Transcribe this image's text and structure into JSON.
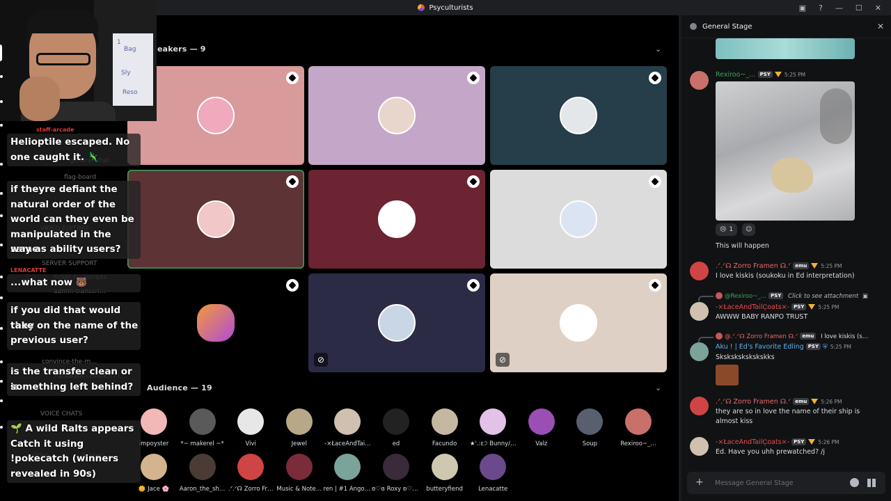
{
  "window": {
    "title": "Psyculturists",
    "controls": [
      "▣",
      "?",
      "—",
      "☐",
      "✕"
    ]
  },
  "stage": {
    "speakers_label": "eakers — 9",
    "audience_label": "Audience — 19",
    "speakers": [
      {
        "color": "#d89a9a",
        "avatar": "#f0a9bd",
        "muted": false
      },
      {
        "color": "#c4a7c8",
        "avatar": "#e8d6cc",
        "muted": false
      },
      {
        "color": "#263d4a",
        "avatar": "#e3e7ea",
        "muted": false
      },
      {
        "color": "#5e3336",
        "avatar": "#f1c7c7",
        "muted": false
      },
      {
        "color": "#6c2332",
        "avatar": "#ffffff",
        "muted": false
      },
      {
        "color": "#dcdcdc",
        "avatar": "#dbe4f2",
        "muted": false
      },
      {
        "color": "#000000",
        "avatar": "#a85fd6",
        "muted": false
      },
      {
        "color": "#2c2b45",
        "avatar": "#c8d6e5",
        "muted": true
      },
      {
        "color": "#ded0c4",
        "avatar": "#ffffff",
        "muted": true
      }
    ],
    "audience": [
      {
        "name": "impoyster",
        "color": "#f2b7b7"
      },
      {
        "name": "*~ makerel ~*",
        "color": "#5a5a5a"
      },
      {
        "name": "Vivi",
        "color": "#e7e7e7"
      },
      {
        "name": "Jewel",
        "color": "#b8a888"
      },
      {
        "name": "-×ŁaceAndTai…",
        "color": "#cfc0b0"
      },
      {
        "name": "ed",
        "color": "#222222"
      },
      {
        "name": "Facundo",
        "color": "#c6b8a0"
      },
      {
        "name": "★'.:ɛ੭ Bunny/…",
        "color": "#e3c2e8"
      },
      {
        "name": "Valz",
        "color": "#9b4fb5"
      },
      {
        "name": "Soup",
        "color": "#586070"
      },
      {
        "name": "Rexiroo~_…",
        "color": "#c9706a"
      },
      {
        "name": "🌼 Jace 🌸",
        "color": "#d4b48e"
      },
      {
        "name": "Aaron_the_sh…",
        "color": "#4a3c34"
      },
      {
        "name": ".ᐟ.ᐟ☊ Zorro Fr…",
        "color": "#cf4444"
      },
      {
        "name": "Music & Note…",
        "color": "#7a2c3a"
      },
      {
        "name": "ren | #1 Angoli…",
        "color": "#7ba39a"
      },
      {
        "name": "ʚ♡ɞ Roxy ʚ♡ɞ…",
        "color": "#3a2a3a"
      },
      {
        "name": "butteryfiend",
        "color": "#cfc8b0"
      },
      {
        "name": "Lenacatte",
        "color": "#6a4a8a"
      }
    ]
  },
  "overlay": {
    "board_lines": [
      "1",
      "Bag",
      "Sly",
      "Reso"
    ],
    "ghost": [
      {
        "text": "staff-arcade",
        "kind": "red"
      },
      {
        "text": "general-chat",
        "kind": "gray"
      },
      {
        "text": "flag-board",
        "kind": "gray"
      },
      {
        "text": "VIDEO EDITING",
        "kind": "gray"
      },
      {
        "text": "SERVER SUPPORT",
        "kind": "gray"
      },
      {
        "text": "LENACATTE",
        "kind": "red"
      },
      {
        "text": "ticket-transcripts",
        "kind": "gray"
      },
      {
        "text": "admin-transcri…",
        "kind": "gray"
      },
      {
        "text": "convince-the-m…",
        "kind": "gray"
      },
      {
        "text": "ParadoxX - HADES / I…",
        "kind": "gray"
      },
      {
        "text": "VOICE CHATS",
        "kind": "gray"
      },
      {
        "text": "Video",
        "kind": "gray"
      },
      {
        "text": "Screen",
        "kind": "gray"
      }
    ],
    "messages": [
      {
        "lines": [
          "Helioptile escaped. No",
          "one caught it. 🦎"
        ]
      },
      {
        "lines": [
          "if theyre defiant the",
          "natural order of the",
          "world can they even be",
          "manipulated in the same",
          "way as ability users?"
        ]
      },
      {
        "lines": [
          "...what now 🐻"
        ]
      },
      {
        "lines": [
          "if you did that would they",
          "take on the name of the",
          "previous user?"
        ]
      },
      {
        "lines": [
          "is the transfer clean or is",
          "something left behind?"
        ]
      },
      {
        "lines": [
          "🌱 A wild Ralts appears",
          "Catch it using",
          "!pokecatch (winners",
          "revealed in 90s)"
        ]
      }
    ]
  },
  "panel": {
    "title": "General Stage",
    "composer_placeholder": "Message General Stage",
    "messages": [
      {
        "user": "Rexiroo~_…",
        "user_color": "#3ba55c",
        "badge": "PSY",
        "time": "5:25 PM",
        "reaction_emoji": "😢",
        "reaction_count": "1",
        "text": "This will happen"
      },
      {
        "user": ".ᐟ.ᐟ☊ Zorro Framen ☊.ᐟ",
        "user_color": "#ed6a6a",
        "badge": "emu",
        "time": "5:25 PM",
        "text": "I love kiskis (soukoku in Ed interpretation)"
      },
      {
        "reply_user": "@Rexiroo~_…",
        "reply_badge": "PSY",
        "reply_text": "Click to see attachment",
        "user": "-×ŁaceAndTailC͙oats×-",
        "user_color": "#ed4a4a",
        "badge": "PSY",
        "time": "5:25 PM",
        "text": "AWWW BABY RANPO TRUST"
      },
      {
        "reply_user": "@.ᐟ.ᐟ☊ Zorro Framen ☊.ᐟ",
        "reply_badge": "emu",
        "reply_text": "I love kiskis (s…",
        "user": "Aku ! | Ed's Favorite Edling",
        "user_color": "#5db3f0",
        "badge": "PSY",
        "time": "5:25 PM",
        "text": "Skskskskskskskks"
      },
      {
        "user": ".ᐟ.ᐟ☊ Zorro Framen ☊.ᐟ",
        "user_color": "#ed6a6a",
        "badge": "emu",
        "time": "5:26 PM",
        "lines": [
          "they are so in love the name of their ship is",
          "almost kiss"
        ]
      },
      {
        "user": "-×ŁaceAndTailC͙oats×-",
        "user_color": "#ed4a4a",
        "badge": "PSY",
        "time": "5:26 PM",
        "text": "Ed. Have you uhh prewatched? /j"
      }
    ]
  }
}
